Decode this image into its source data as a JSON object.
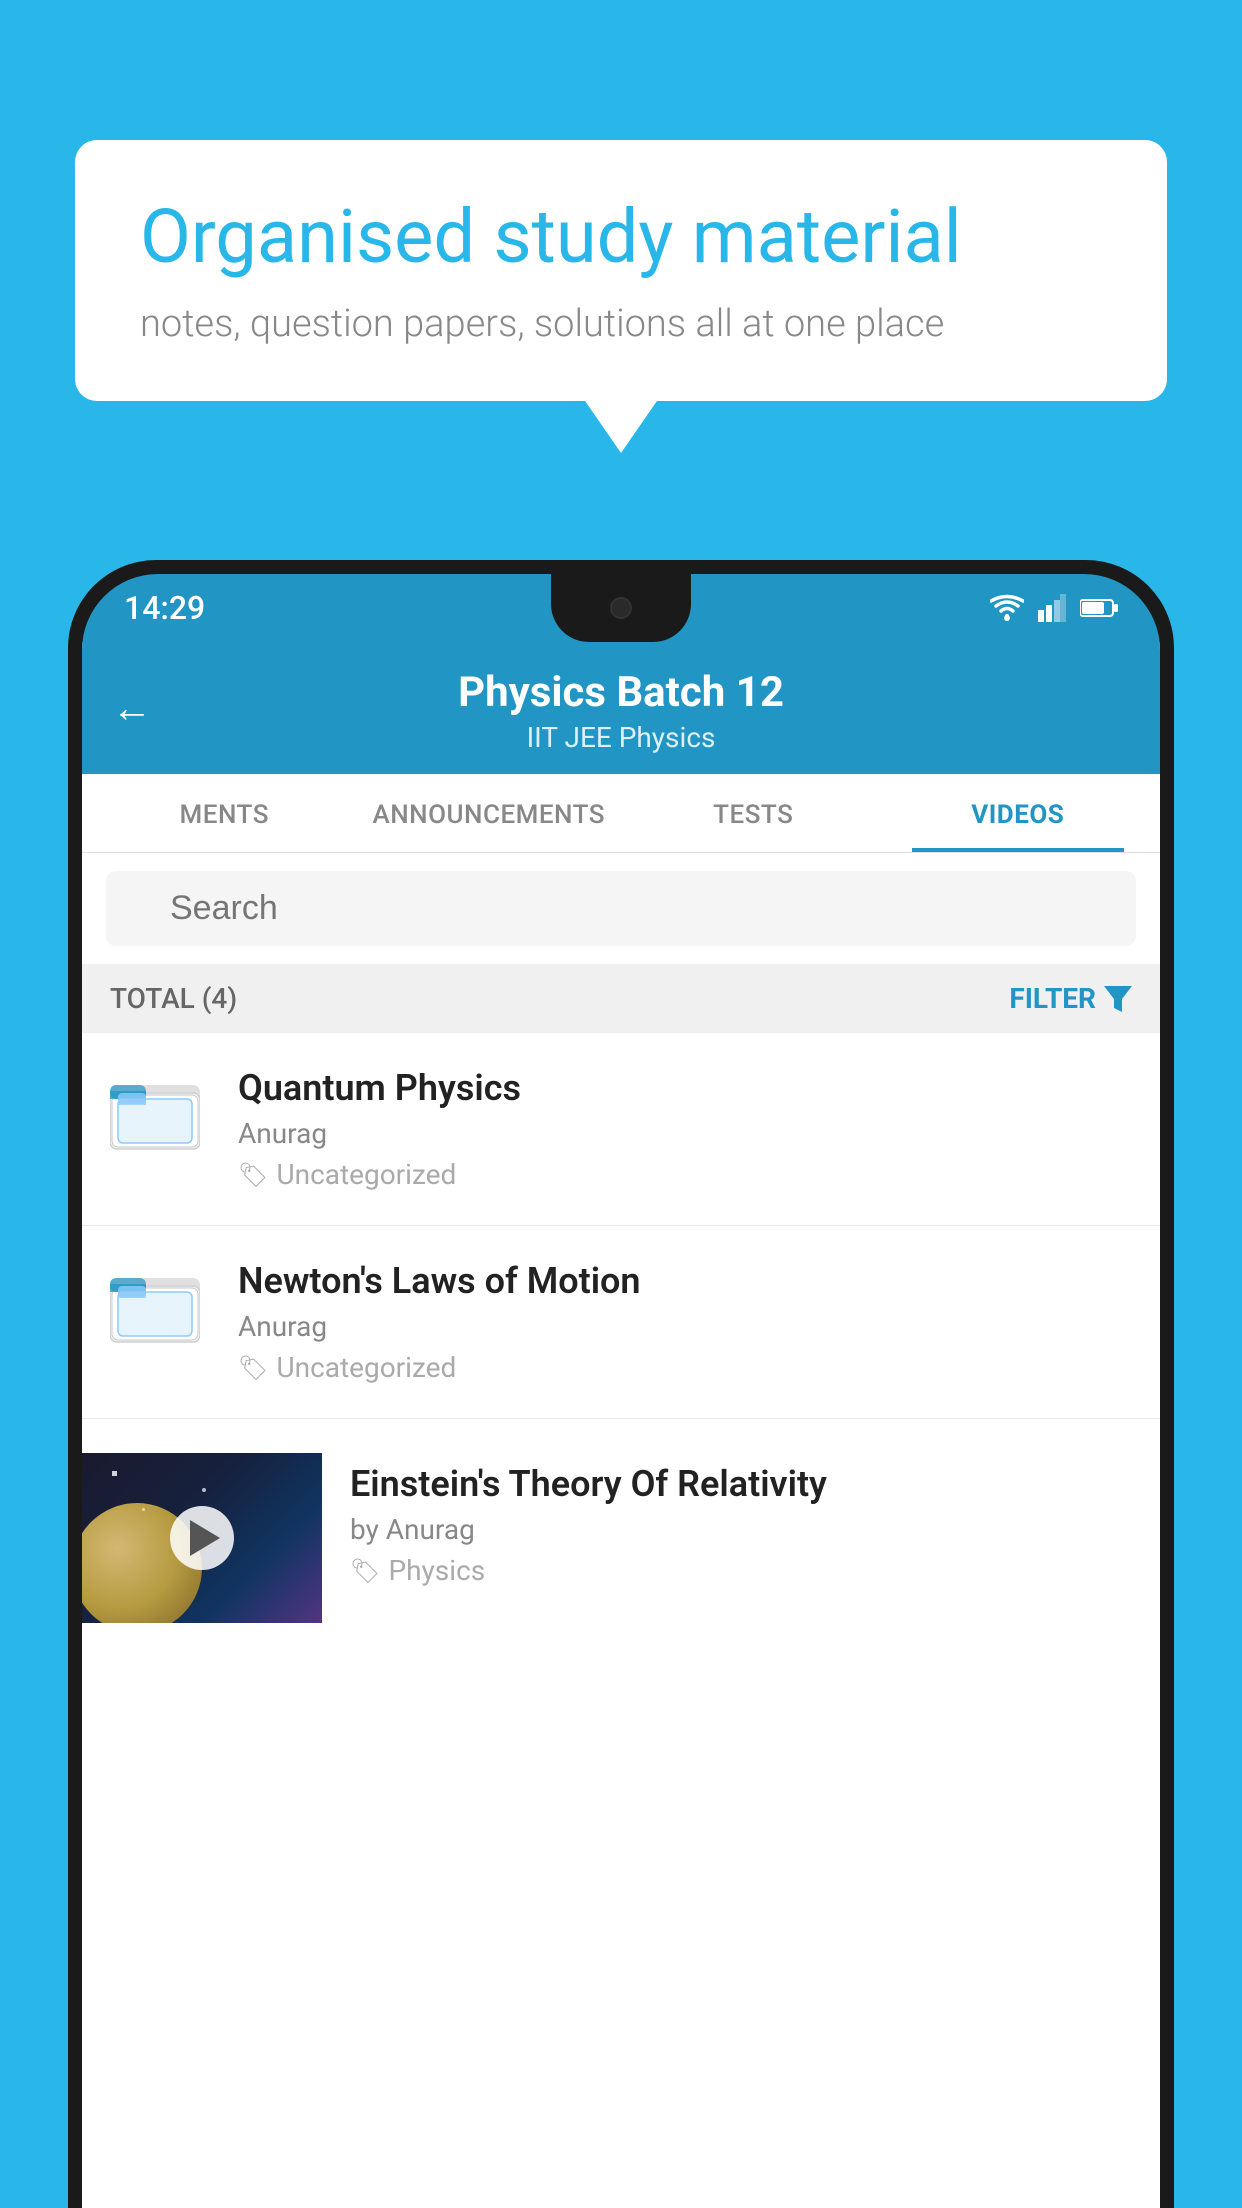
{
  "background_color": "#29B6E8",
  "speech_bubble": {
    "heading": "Organised study material",
    "subtext": "notes, question papers, solutions all at one place"
  },
  "phone": {
    "status_bar": {
      "time": "14:29"
    },
    "header": {
      "back_label": "←",
      "title": "Physics Batch 12",
      "subtitle": "IIT JEE   Physics"
    },
    "tabs": [
      {
        "label": "MENTS",
        "active": false
      },
      {
        "label": "ANNOUNCEMENTS",
        "active": false
      },
      {
        "label": "TESTS",
        "active": false
      },
      {
        "label": "VIDEOS",
        "active": true
      }
    ],
    "search": {
      "placeholder": "Search"
    },
    "filter_bar": {
      "total_label": "TOTAL (4)",
      "filter_label": "FILTER"
    },
    "videos": [
      {
        "title": "Quantum Physics",
        "author": "Anurag",
        "tag": "Uncategorized",
        "has_thumbnail": false
      },
      {
        "title": "Newton's Laws of Motion",
        "author": "Anurag",
        "tag": "Uncategorized",
        "has_thumbnail": false
      },
      {
        "title": "Einstein's Theory Of Relativity",
        "author": "by Anurag",
        "tag": "Physics",
        "has_thumbnail": true
      }
    ]
  }
}
